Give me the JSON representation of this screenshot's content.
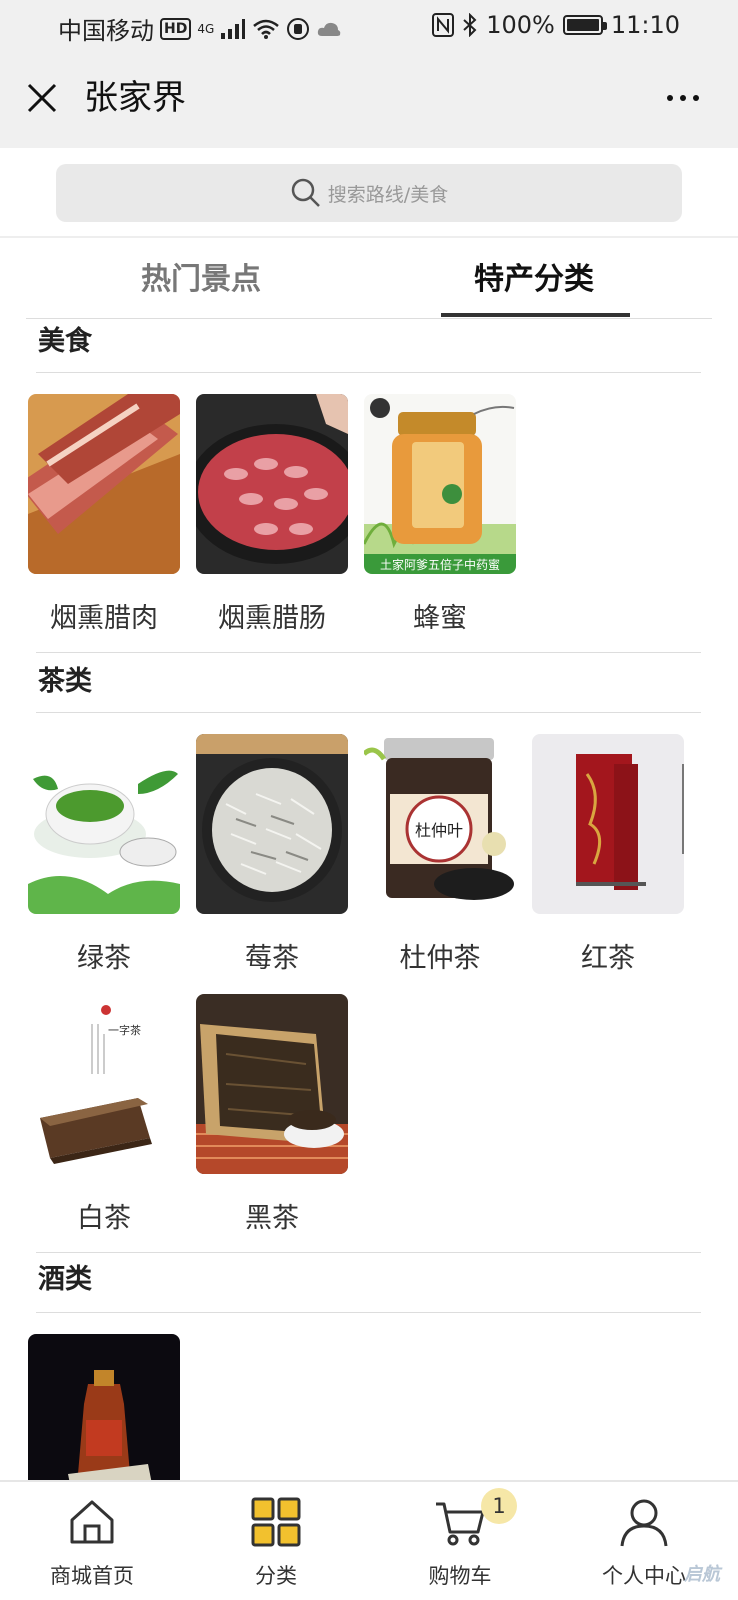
{
  "status_bar": {
    "carrier": "中国移动",
    "hd": "HD",
    "network": "4G",
    "battery": "100%",
    "time": "11:10"
  },
  "header": {
    "title": "张家界"
  },
  "search": {
    "placeholder": "搜索路线/美食"
  },
  "tabs": [
    {
      "label": "热门景点",
      "active": false
    },
    {
      "label": "特产分类",
      "active": true
    }
  ],
  "sections": [
    {
      "title": "美食",
      "items": [
        {
          "label": "烟熏腊肉",
          "image_text": ""
        },
        {
          "label": "烟熏腊肠",
          "image_text": ""
        },
        {
          "label": "蜂蜜",
          "image_text": "土家阿爹五倍子中药蜜"
        }
      ]
    },
    {
      "title": "茶类",
      "items": [
        {
          "label": "绿茶",
          "image_text": ""
        },
        {
          "label": "莓茶",
          "image_text": ""
        },
        {
          "label": "杜仲茶",
          "image_text": "杜仲叶"
        },
        {
          "label": "红茶",
          "image_text": ""
        },
        {
          "label": "白茶",
          "image_text": "一字茶"
        },
        {
          "label": "黑茶",
          "image_text": ""
        }
      ]
    },
    {
      "title": "酒类",
      "items": [
        {
          "label": "",
          "image_text": ""
        }
      ]
    }
  ],
  "bottom_nav": [
    {
      "label": "商城首页",
      "icon": "home-icon",
      "active": false
    },
    {
      "label": "分类",
      "icon": "category-grid-icon",
      "active": true
    },
    {
      "label": "购物车",
      "icon": "cart-icon",
      "active": false,
      "badge": "1"
    },
    {
      "label": "个人中心",
      "icon": "user-icon",
      "active": false
    }
  ],
  "colors": {
    "accent_yellow": "#f2c12e",
    "badge_bg": "#f6e7a7",
    "header_bg": "#f0f0f0",
    "tab_underline": "#333333"
  },
  "watermark": "启航"
}
